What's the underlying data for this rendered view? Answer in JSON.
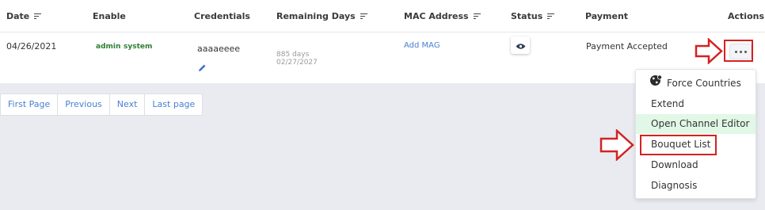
{
  "table": {
    "headers": {
      "date": "Date",
      "enable": "Enable",
      "credentials": "Credentials",
      "remaining_days": "Remaining Days",
      "mac_address": "MAC Address",
      "status": "Status",
      "payment": "Payment",
      "actions": "Actions"
    },
    "row": {
      "date": "04/26/2021",
      "enable_tags": [
        "admin",
        "system"
      ],
      "credentials": "aaaaeeee",
      "remaining_days": "885 days",
      "expiry_date": "02/27/2027",
      "mac_action": "Add MAG",
      "payment": "Payment Accepted"
    }
  },
  "pagination": [
    "First Page",
    "Previous",
    "Next",
    "Last page"
  ],
  "actions_menu": {
    "items": [
      {
        "label": "Force Countries",
        "icon": "globe-icon"
      },
      {
        "label": "Extend"
      },
      {
        "label": "Open Channel Editor",
        "active": true
      },
      {
        "label": "Bouquet List",
        "highlighted": true
      },
      {
        "label": "Download"
      },
      {
        "label": "Diagnosis"
      }
    ]
  },
  "colors": {
    "annotation_red": "#d42222",
    "link_blue": "#4a7fd4",
    "tag_green": "#2e7d32",
    "active_item_bg": "#e1f8e6",
    "page_bg": "#e9ebf1"
  }
}
